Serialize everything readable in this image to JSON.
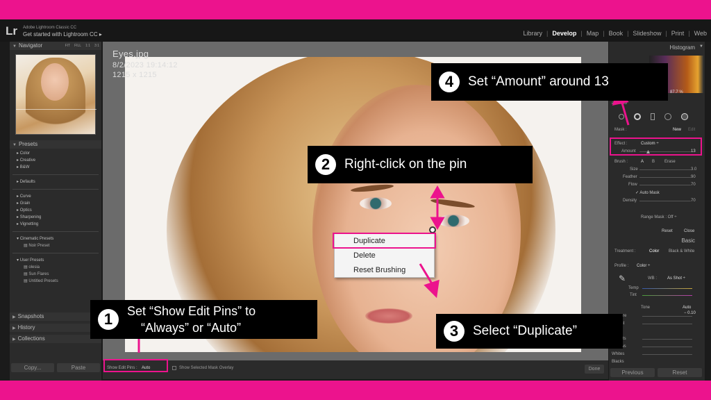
{
  "app": {
    "logo": "Lr",
    "subtitle": "Adobe Lightroom Classic CC",
    "get_started": "Get started with Lightroom CC  ▸"
  },
  "modules": [
    "Library",
    "Develop",
    "Map",
    "Book",
    "Slideshow",
    "Print",
    "Web"
  ],
  "active_module": "Develop",
  "left_panel": {
    "navigator": "Navigator",
    "nav_zoom": [
      "FIT",
      "FILL",
      "1:1",
      "3:1"
    ],
    "presets": "Presets",
    "preset_groups_1": [
      "Color",
      "Creative",
      "B&W"
    ],
    "preset_groups_2": [
      "Defaults"
    ],
    "preset_groups_3": [
      "Curve",
      "Grain",
      "Optics",
      "Sharpening",
      "Vignetting"
    ],
    "cinematic": "Cinematic Presets",
    "noir": "Noir Preset",
    "user_presets": "User Presets",
    "user_items": [
      "olesia",
      "Sun Flares",
      "Untitled Presets"
    ],
    "snapshots": "Snapshots",
    "history": "History",
    "collections": "Collections",
    "copy": "Copy...",
    "paste": "Paste"
  },
  "image_info": {
    "name": "Eyes.jpg",
    "date": "8/2/2023 19:14:12",
    "size": "1215 x 1215"
  },
  "toolbar": {
    "show_pins_label": "Show Edit Pins :",
    "show_pins_value": "Auto",
    "overlay_label": "Show Selected Mask Overlay",
    "done": "Done"
  },
  "context_menu": [
    "Duplicate",
    "Delete",
    "Reset Brushing"
  ],
  "right_panel": {
    "histogram": "Histogram",
    "histo_val": "87.7 %",
    "photo_label": "al Photo",
    "mask": "Mask :",
    "new": "New",
    "edit": "Edit",
    "effect": "Effect :",
    "effect_val": "Custom  ÷",
    "amount": "Amount",
    "amount_val": "13",
    "brush": "Brush :",
    "brush_a": "A",
    "brush_b": "B",
    "erase": "Erase",
    "size": "Size",
    "size_val": "3.0",
    "feather": "Feather",
    "feather_val": "90",
    "flow": "Flow",
    "flow_val": "70",
    "auto_mask": "Auto Mask",
    "density": "Density",
    "density_val": "70",
    "range_mask": "Range Mask : Off  ÷",
    "reset": "Reset",
    "close": "Close",
    "basic": "Basic",
    "treatment": "Treatment :",
    "color": "Color",
    "bw": "Black & White",
    "profile": "Profile :",
    "profile_val": "Color  ÷",
    "wb": "WB :",
    "wb_val": "As Shot  ÷",
    "temp": "Temp",
    "tint": "Tint",
    "tone": "Tone",
    "auto": "Auto",
    "exposure": "xposure",
    "exposure_val": "− 0.10",
    "contrast": "ontrast",
    "highlights": "ghlights",
    "shadows": "hadows",
    "whites": "Whites",
    "blacks": "Blacks",
    "previous": "Previous",
    "reset_btn": "Reset"
  },
  "callouts": {
    "c1_num": "1",
    "c1_line1": "Set “Show Edit Pins” to",
    "c1_line2": "“Always” or “Auto”",
    "c2_num": "2",
    "c2_text": "Right-click on the pin",
    "c3_num": "3",
    "c3_text": "Select “Duplicate”",
    "c4_num": "4",
    "c4_text": "Set “Amount” around 13"
  },
  "colors": {
    "accent": "#ec138d",
    "background": "#1b1b1b"
  }
}
